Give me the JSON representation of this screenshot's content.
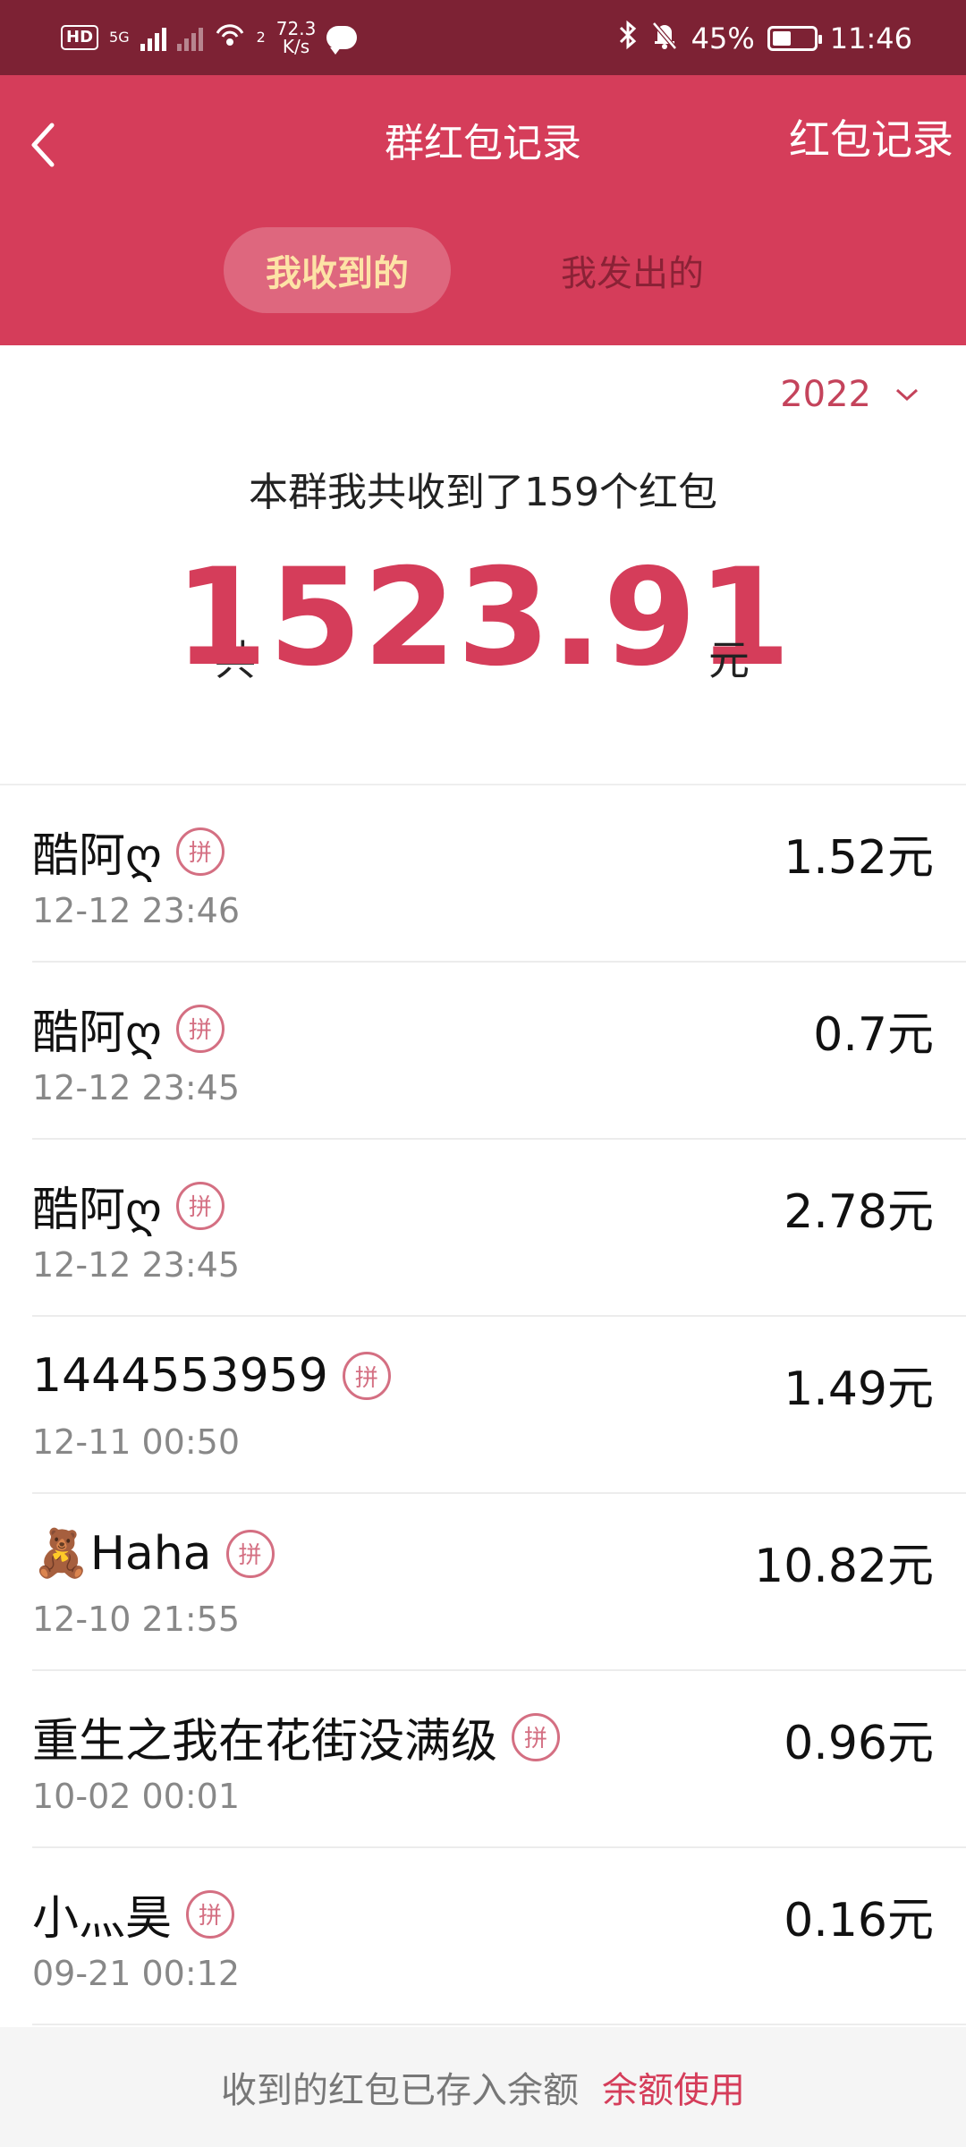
{
  "status_bar": {
    "hd_label": "HD",
    "network_label": "5G",
    "wifi_label": "2",
    "speed_value": "72.3",
    "speed_unit": "K/s",
    "battery_text": "45%",
    "battery_level": 0.45,
    "time": "11:46"
  },
  "header": {
    "title": "群红包记录",
    "records_link": "红包记录",
    "tabs": [
      {
        "label": "我收到的",
        "active": true
      },
      {
        "label": "我发出的",
        "active": false
      }
    ]
  },
  "summary": {
    "year": "2022",
    "description": "本群我共收到了159个红包",
    "total_prefix": "共",
    "total_amount": "1523.91",
    "total_suffix": "元"
  },
  "badge_label": "拼",
  "records": [
    {
      "name": "酷阿ღ",
      "time": "12-12 23:46",
      "amount": "1.52元"
    },
    {
      "name": "酷阿ღ",
      "time": "12-12 23:45",
      "amount": "0.7元"
    },
    {
      "name": "酷阿ღ",
      "time": "12-12 23:45",
      "amount": "2.78元"
    },
    {
      "name": "1444553959",
      "time": "12-11 00:50",
      "amount": "1.49元"
    },
    {
      "name": "🧸Haha",
      "time": "12-10 21:55",
      "amount": "10.82元"
    },
    {
      "name": "重生之我在花街没满级",
      "time": "10-02 00:01",
      "amount": "0.96元"
    },
    {
      "name": "小灬昊",
      "time": "09-21 00:12",
      "amount": "0.16元"
    }
  ],
  "footer": {
    "note": "收到的红包已存入余额",
    "link": "余额使用"
  },
  "colors": {
    "status_bar": "#7d2234",
    "header": "#d53d5a",
    "accent": "#d53d5a",
    "active_tab_text": "#fde3a6"
  }
}
